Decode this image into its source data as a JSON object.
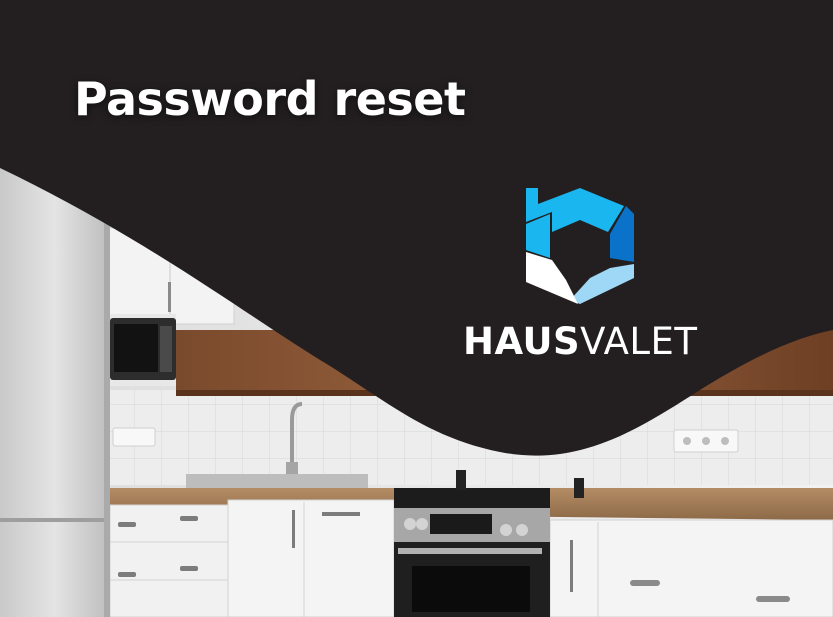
{
  "headline": "Password reset",
  "brand": {
    "name_bold": "HAUS",
    "name_light": "VALET"
  },
  "colors": {
    "dark_panel": "#231f20",
    "logo_blue_bright": "#1ab6f0",
    "logo_blue_dark": "#0a72c8",
    "logo_blue_light": "#9ed8f6",
    "logo_white": "#ffffff"
  },
  "icons": [
    "hausvalet-logo-icon"
  ]
}
